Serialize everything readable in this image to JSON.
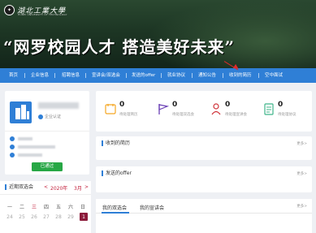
{
  "header": {
    "logo_text": "湖北工業大學",
    "logo_sub": "HUBEI UNIVERSITY OF TECHNOLOGY",
    "slogan": "“网罗校园人才  搭造美好未来”"
  },
  "nav": {
    "items": [
      "首页",
      "企业信息",
      "招聘信息",
      "宣讲会/双选会",
      "发送的offer",
      "就业协议",
      "通知公告",
      "收到的简历",
      "空中面试"
    ],
    "active_index": 7
  },
  "profile": {
    "auth_label": "企业认证",
    "passed_label": "已通过"
  },
  "stats": [
    {
      "value": "0",
      "label": "待处理简历",
      "icon": "notepad-icon",
      "color": "#f5a623"
    },
    {
      "value": "0",
      "label": "待处理双选会",
      "icon": "flag-icon",
      "color": "#6a3fb5"
    },
    {
      "value": "0",
      "label": "待处理宣讲会",
      "icon": "person-icon",
      "color": "#d0343a"
    },
    {
      "value": "0",
      "label": "待处理协议",
      "icon": "document-icon",
      "color": "#3fb58a"
    }
  ],
  "panels": {
    "received": {
      "title": "收到的简历",
      "more": "更多>"
    },
    "sent_offer": {
      "title": "发送的offer",
      "more": "更多>"
    }
  },
  "tabs": {
    "items": [
      "我的双选会",
      "我的宣讲会"
    ],
    "more": "更多>"
  },
  "calendar": {
    "title": "近期双选会",
    "prev": "<",
    "year": "2020年",
    "month": "3月",
    "next": ">",
    "weekdays": [
      "一",
      "二",
      "三",
      "四",
      "五",
      "六",
      "日"
    ],
    "week1": [
      "24",
      "25",
      "26",
      "27",
      "28",
      "29",
      "1"
    ],
    "today": "1"
  },
  "colors": {
    "primary": "#2f7fd6",
    "header_bg": "#1d3624",
    "accent_red": "#c3223d",
    "success": "#27a745"
  }
}
